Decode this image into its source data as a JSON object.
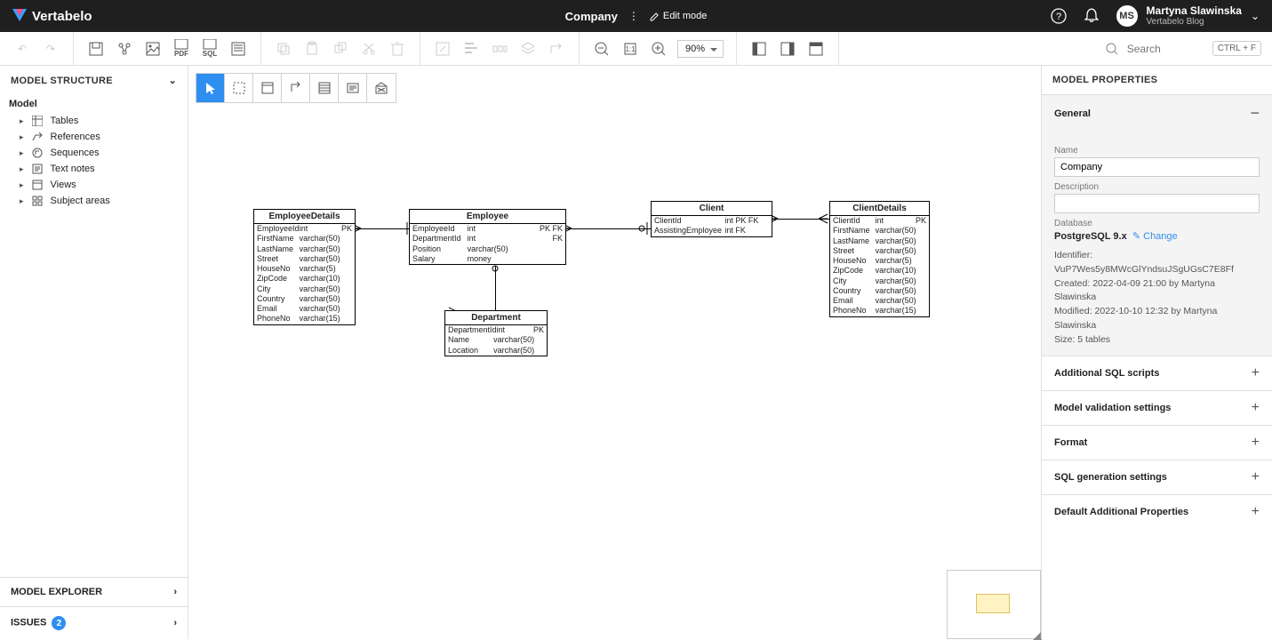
{
  "header": {
    "brand": "Vertabelo",
    "modelTitle": "Company",
    "editMode": "Edit mode"
  },
  "user": {
    "initials": "MS",
    "name": "Martyna Slawinska",
    "org": "Vertabelo Blog"
  },
  "toolbar": {
    "zoom": "90%",
    "searchPlaceholder": "Search",
    "searchShortcut": "CTRL + F"
  },
  "leftPanel": {
    "title": "MODEL STRUCTURE",
    "root": "Model",
    "items": [
      "Tables",
      "References",
      "Sequences",
      "Text notes",
      "Views",
      "Subject areas"
    ],
    "explorer": "MODEL EXPLORER",
    "issues": "ISSUES",
    "issuesCount": "2"
  },
  "rightPanel": {
    "title": "MODEL PROPERTIES",
    "generalTitle": "General",
    "nameLabel": "Name",
    "nameValue": "Company",
    "descLabel": "Description",
    "dbLabel": "Database",
    "dbValue": "PostgreSQL 9.x",
    "changeLabel": "Change",
    "meta": {
      "identifierLabel": "Identifier:",
      "identifier": "VuP7Wes5y8MWcGlYndsuJSgUGsC7E8Ff",
      "createdLabel": "Created:",
      "created": "2022-04-09 21:00 by Martyna Slawinska",
      "modifiedLabel": "Modified:",
      "modified": "2022-10-10 12:32 by Martyna Slawinska",
      "sizeLabel": "Size:",
      "size": "5 tables"
    },
    "sections": [
      "Additional SQL scripts",
      "Model validation settings",
      "Format",
      "SQL generation settings",
      "Default Additional Properties"
    ]
  },
  "tables": {
    "EmployeeDetails": {
      "title": "EmployeeDetails",
      "rows": [
        [
          "EmployeeId",
          "int",
          "PK"
        ],
        [
          "FirstName",
          "varchar(50)",
          ""
        ],
        [
          "LastName",
          "varchar(50)",
          ""
        ],
        [
          "Street",
          "varchar(50)",
          ""
        ],
        [
          "HouseNo",
          "varchar(5)",
          ""
        ],
        [
          "ZipCode",
          "varchar(10)",
          ""
        ],
        [
          "City",
          "varchar(50)",
          ""
        ],
        [
          "Country",
          "varchar(50)",
          ""
        ],
        [
          "Email",
          "varchar(50)",
          ""
        ],
        [
          "PhoneNo",
          "varchar(15)",
          ""
        ]
      ]
    },
    "Employee": {
      "title": "Employee",
      "rows": [
        [
          "EmployeeId",
          "int",
          "PK FK"
        ],
        [
          "DepartmentId",
          "int",
          "FK"
        ],
        [
          "Position",
          "varchar(50)",
          ""
        ],
        [
          "Salary",
          "money",
          ""
        ]
      ]
    },
    "Client": {
      "title": "Client",
      "rows": [
        [
          "ClientId",
          "int PK FK",
          ""
        ],
        [
          "AssistingEmployee",
          "int FK",
          ""
        ]
      ]
    },
    "ClientDetails": {
      "title": "ClientDetails",
      "rows": [
        [
          "ClientId",
          "int",
          "PK"
        ],
        [
          "FirstName",
          "varchar(50)",
          ""
        ],
        [
          "LastName",
          "varchar(50)",
          ""
        ],
        [
          "Street",
          "varchar(50)",
          ""
        ],
        [
          "HouseNo",
          "varchar(5)",
          ""
        ],
        [
          "ZipCode",
          "varchar(10)",
          ""
        ],
        [
          "City",
          "varchar(50)",
          ""
        ],
        [
          "Country",
          "varchar(50)",
          ""
        ],
        [
          "Email",
          "varchar(50)",
          ""
        ],
        [
          "PhoneNo",
          "varchar(15)",
          ""
        ]
      ]
    },
    "Department": {
      "title": "Department",
      "rows": [
        [
          "DepartmentId",
          "int",
          "PK"
        ],
        [
          "Name",
          "varchar(50)",
          ""
        ],
        [
          "Location",
          "varchar(50)",
          ""
        ]
      ]
    }
  }
}
